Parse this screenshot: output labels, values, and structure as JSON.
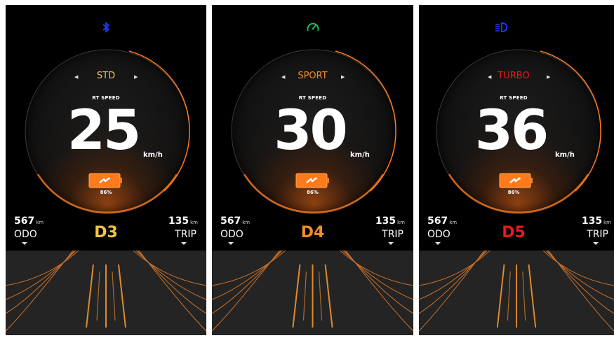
{
  "panels": [
    {
      "top_icon": "bluetooth-icon",
      "top_icon_color": "#1f3bff",
      "mode": "STD",
      "mode_color": "#f2c14e",
      "rt_label": "RT SPEED",
      "speed": "25",
      "unit": "km/h",
      "battery_pct": "86%",
      "odo_value": "567",
      "odo_unit": "km",
      "odo_label": "ODO",
      "trip_value": "135",
      "trip_unit": "km",
      "trip_label": "TRIP",
      "gear": "D3",
      "gear_color": "#f5c542"
    },
    {
      "top_icon": "speedometer-icon",
      "top_icon_color": "#22c55e",
      "mode": "SPORT",
      "mode_color": "#f28c28",
      "rt_label": "RT SPEED",
      "speed": "30",
      "unit": "km/h",
      "battery_pct": "86%",
      "odo_value": "567",
      "odo_unit": "km",
      "odo_label": "ODO",
      "trip_value": "135",
      "trip_unit": "km",
      "trip_label": "TRIP",
      "gear": "D4",
      "gear_color": "#f28c28"
    },
    {
      "top_icon": "headlight-icon",
      "top_icon_color": "#1f3bff",
      "mode": "TURBO",
      "mode_color": "#e61b1b",
      "rt_label": "RT SPEED",
      "speed": "36",
      "unit": "km/h",
      "battery_pct": "86%",
      "odo_value": "567",
      "odo_unit": "km",
      "odo_label": "ODO",
      "trip_value": "135",
      "trip_unit": "km",
      "trip_label": "TRIP",
      "gear": "D5",
      "gear_color": "#e61b1b"
    }
  ],
  "accent_color": "#ff7a1a"
}
